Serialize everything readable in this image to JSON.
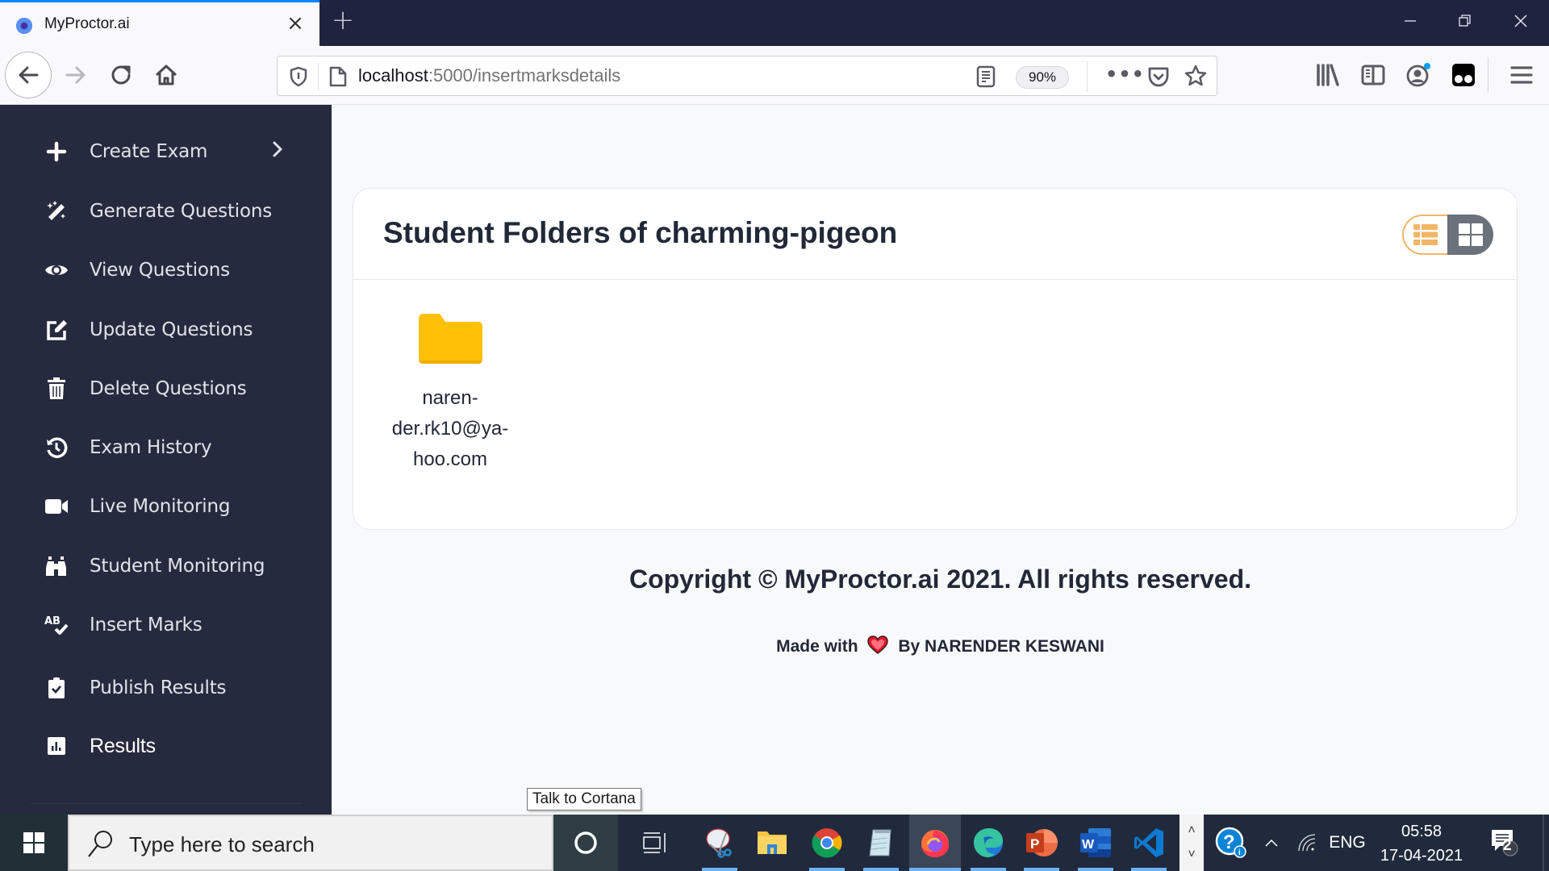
{
  "browser": {
    "tab_title": "MyProctor.ai",
    "tab_close": "×",
    "new_tab": "+",
    "window_controls": {
      "minimize": "—",
      "restore": "❐",
      "close": "✕"
    },
    "url_host": "localhost",
    "url_rest": ":5000/insertmarksdetails",
    "zoom_level": "90%",
    "more_label": "•••"
  },
  "sidebar": {
    "items": [
      {
        "label": "Create Exam",
        "icon": "plus-icon",
        "has_submenu": true
      },
      {
        "label": "Generate Questions",
        "icon": "magic-wand-icon"
      },
      {
        "label": "View Questions",
        "icon": "eye-icon"
      },
      {
        "label": "Update Questions",
        "icon": "edit-icon"
      },
      {
        "label": "Delete Questions",
        "icon": "trash-icon"
      },
      {
        "label": "Exam History",
        "icon": "history-icon"
      },
      {
        "label": "Live Monitoring",
        "icon": "video-icon"
      },
      {
        "label": "Student Monitoring",
        "icon": "binoculars-icon"
      },
      {
        "label": "Insert Marks",
        "icon": "spell-check-icon"
      },
      {
        "label": "Publish Results",
        "icon": "clipboard-check-icon"
      },
      {
        "label": "Results",
        "icon": "chart-icon"
      }
    ],
    "chevron": "›"
  },
  "main": {
    "title": "Student Folders of charming-pigeon",
    "view_toggle": {
      "options": [
        "list",
        "grid"
      ],
      "selected": "grid"
    },
    "folders": [
      {
        "name": "naren-der.rk10@ya-hoo.com",
        "display_lines": [
          "naren-",
          "der.rk10@ya-",
          "hoo.com"
        ],
        "color": "#ffc107"
      }
    ]
  },
  "footer": {
    "copyright": "Copyright © MyProctor.ai 2021. All rights reserved.",
    "made_with_prefix": "Made with",
    "made_with_suffix": "By NARENDER KESWANI"
  },
  "tooltip": "Talk to Cortana",
  "taskbar": {
    "search_placeholder": "Type here to search",
    "apps": [
      "Snipping Tool",
      "File Explorer",
      "Google Chrome",
      "Notepad",
      "Firefox",
      "Microsoft Edge",
      "PowerPoint",
      "Word",
      "Visual Studio Code"
    ],
    "active_app": "Firefox",
    "language": "ENG",
    "time": "05:58",
    "date": "17-04-2021",
    "notification_count": "2"
  }
}
